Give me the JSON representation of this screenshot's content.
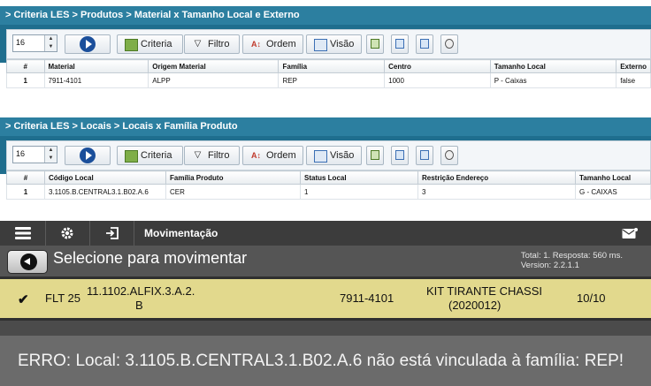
{
  "panels": [
    {
      "breadcrumb": "> Criteria LES > Produtos > Material x Tamanho Local e Externo",
      "spinner_value": "16",
      "toolbar": {
        "criteria": "Criteria",
        "filtro": "Filtro",
        "ordem": "Ordem",
        "visao": "Visão"
      },
      "columns": [
        "#",
        "Material",
        "Origem Material",
        "Família",
        "Centro",
        "Tamanho Local",
        "Externo"
      ],
      "rows": [
        [
          "1",
          "7911-4101",
          "ALPP",
          "REP",
          "1000",
          "P - Caixas",
          "false"
        ]
      ]
    },
    {
      "breadcrumb": "> Criteria LES > Locais > Locais x Família Produto",
      "spinner_value": "16",
      "toolbar": {
        "criteria": "Criteria",
        "filtro": "Filtro",
        "ordem": "Ordem",
        "visao": "Visão"
      },
      "columns": [
        "#",
        "Código Local",
        "Família Produto",
        "Status Local",
        "Restrição Endereço",
        "Tamanho Local"
      ],
      "rows": [
        [
          "1",
          "3.1105.B.CENTRAL3.1.B02.A.6",
          "CER",
          "1",
          "3",
          "G - CAIXAS"
        ]
      ]
    }
  ],
  "mobile": {
    "screen_title": "Movimentação",
    "heading": "Selecione para movimentar",
    "total_line": "Total: 1. Resposta: 560 ms.",
    "version_line": "Version: 2.2.1.1",
    "item": {
      "flt": "FLT 25",
      "local_line1": "11.1102.ALFIX.3.A.2.",
      "local_line2": "B",
      "material": "7911-4101",
      "desc_line1": "KIT TIRANTE CHASSI",
      "desc_line2": "(2020012)",
      "qty": "10/10"
    },
    "error": "ERRO: Local: 3.1105.B.CENTRAL3.1.B02.A.6 não está vinculada à família: REP!"
  },
  "colors": {
    "title_bar": "#2c7fa0",
    "item_highlight": "#e2d98d",
    "dark_bg": "#4b4b4b"
  }
}
